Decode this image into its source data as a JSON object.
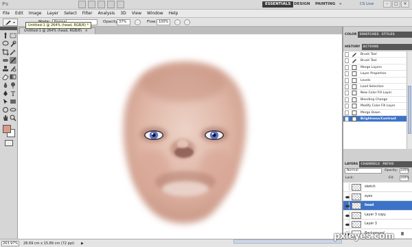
{
  "app": {
    "logo": "Ps",
    "workspaces": [
      "ESSENTIALS",
      "DESIGN",
      "PAINTING"
    ],
    "active_workspace": "ESSENTIALS",
    "more": "»",
    "cs_live": "CS Live"
  },
  "menu": [
    "File",
    "Edit",
    "Image",
    "Layer",
    "Select",
    "Filter",
    "Analysis",
    "3D",
    "View",
    "Window",
    "Help"
  ],
  "options": {
    "mode_label": "Mode:",
    "mode_value": "Normal",
    "opacity_label": "Opacity:",
    "opacity_value": "37%",
    "flow_label": "Flow:",
    "flow_value": "100%"
  },
  "document": {
    "tab_label": "Untitled-1 @ 264% (head, RGB/8)",
    "tab_close": "×",
    "tooltip": "Untitled-1 @ 264% (head, RGB/8) *"
  },
  "status": {
    "zoom": "263.97%",
    "info": "28.69 cm x 15.89 cm (72 ppi)",
    "arrow": "▶"
  },
  "panels": {
    "top_tabs": [
      "COLOR",
      "SWATCHES",
      "STYLES"
    ],
    "history_tabs": [
      "HISTORY",
      "ACTIONS"
    ],
    "history_items": [
      {
        "label": "Brush Tool",
        "icon": "brush"
      },
      {
        "label": "Brush Tool",
        "icon": "brush"
      },
      {
        "label": "Merge Layers",
        "icon": "doc"
      },
      {
        "label": "Layer Properties",
        "icon": "doc"
      },
      {
        "label": "Levels",
        "icon": "doc"
      },
      {
        "label": "Load Selection",
        "icon": "doc"
      },
      {
        "label": "New Color Fill Layer",
        "icon": "doc"
      },
      {
        "label": "Blending Change",
        "icon": "doc"
      },
      {
        "label": "Modify Color Fill Layer",
        "icon": "doc"
      },
      {
        "label": "Merge Down",
        "icon": "doc"
      },
      {
        "label": "Brightness/Contrast",
        "icon": "doc",
        "selected": true
      }
    ],
    "layer_tabs": [
      "LAYERS",
      "CHANNELS",
      "PATHS"
    ],
    "blend_mode": "Normal",
    "opacity_label": "Opacity:",
    "opacity_value": "100%",
    "lock_label": "Lock:",
    "fill_label": "Fill:",
    "fill_value": "100%",
    "layers": [
      {
        "name": "sketch",
        "visible": false,
        "selected": false
      },
      {
        "name": "eyes",
        "visible": true,
        "selected": false
      },
      {
        "name": "head",
        "visible": true,
        "selected": true
      },
      {
        "name": "Layer 3 copy",
        "visible": true,
        "selected": false
      },
      {
        "name": "Layer 3",
        "visible": true,
        "selected": false
      },
      {
        "name": "Background",
        "visible": true,
        "selected": false,
        "italic": true,
        "locked": true
      }
    ]
  },
  "watermark": "pxleyes.com",
  "colors": {
    "foreground": "#d99a8a",
    "background": "#ffffff",
    "selection": "#3c73c9",
    "skin": "#e7c3b4",
    "iris": "#6c86d8"
  }
}
